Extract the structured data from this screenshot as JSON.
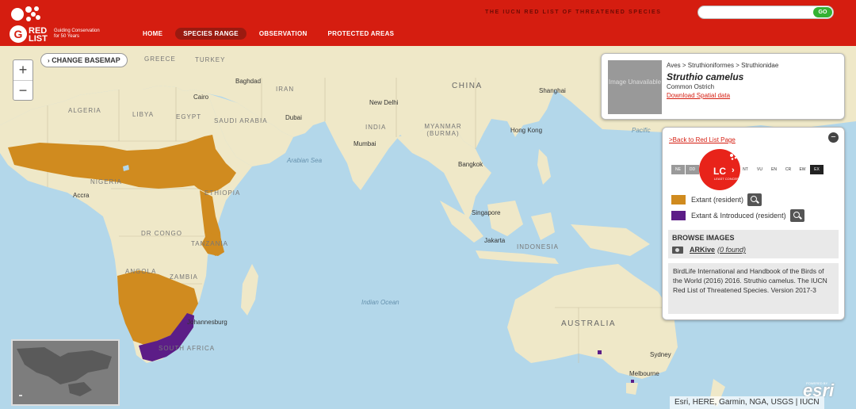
{
  "header": {
    "logo": {
      "red_list": "RED LIST",
      "tagline": "Guiding Conservation for 50 Years"
    },
    "tagline": "THE IUCN RED LIST OF THREATENED SPECIES",
    "nav": [
      {
        "label": "HOME",
        "active": false
      },
      {
        "label": "SPECIES RANGE",
        "active": true
      },
      {
        "label": "OBSERVATION",
        "active": false
      },
      {
        "label": "PROTECTED AREAS",
        "active": false
      }
    ],
    "search": {
      "value": "",
      "button": "GO"
    }
  },
  "map": {
    "change_basemap": "CHANGE BASEMAP",
    "zoom_in": "+",
    "zoom_out": "−",
    "labels": {
      "countries": [
        "GREECE",
        "TURKEY",
        "IRAN",
        "ALGERIA",
        "LIBYA",
        "EGYPT",
        "SAUDI ARABIA",
        "INDIA",
        "MYANMAR (BURMA)",
        "CHINA",
        "NIGERIA",
        "ETHIOPIA",
        "DR CONGO",
        "TANZANIA",
        "ANGOLA",
        "ZAMBIA",
        "SOUTH AFRICA",
        "INDONESIA",
        "AUSTRALIA"
      ],
      "cities": [
        "Baghdad",
        "Cairo",
        "Dubai",
        "New Delhi",
        "Mumbai",
        "Shanghai",
        "Hong Kong",
        "Bangkok",
        "Singapore",
        "Jakarta",
        "Accra",
        "Johannesburg",
        "Sydney",
        "Melbourne"
      ],
      "seas": [
        "Arabian Sea",
        "Indian Ocean",
        "Pacific"
      ]
    },
    "attribution": "Esri, HERE, Garmin, NGA, USGS | IUCN",
    "esri": {
      "powered_by": "POWERED BY",
      "logo": "esri"
    }
  },
  "species": {
    "image_placeholder": "Image Unavailable",
    "taxonomy": "Aves > Struthioniformes > Struthionidae",
    "scientific_name": "Struthio camelus",
    "common_name": "Common Ostrich",
    "download_link": "Download Spatial data"
  },
  "status_panel": {
    "back_link": ">Back to Red List Page",
    "close": "−",
    "category": {
      "code": "LC",
      "subtitle": "LEAST CONCERN"
    },
    "scale": [
      "NE",
      "DD",
      "LC",
      "NT",
      "VU",
      "EN",
      "CR",
      "EW",
      "EX"
    ],
    "legend": [
      {
        "label": "Extant (resident)",
        "color": "#d08b1f"
      },
      {
        "label": "Extant & Introduced (resident)",
        "color": "#5c1d87"
      }
    ],
    "browse_images": {
      "title": "BROWSE IMAGES",
      "source": "ARKive",
      "count": "(0 found)"
    },
    "citation": "BirdLife International and Handbook of the Birds of the World (2016) 2016. Struthio camelus. The IUCN Red List of Threatened Species. Version 2017-3"
  },
  "colors": {
    "header_red": "#d51d10",
    "ocean": "#b3d7ea",
    "land": "#efe8c8",
    "extant": "#d08b1f",
    "introduced": "#5c1d87"
  }
}
